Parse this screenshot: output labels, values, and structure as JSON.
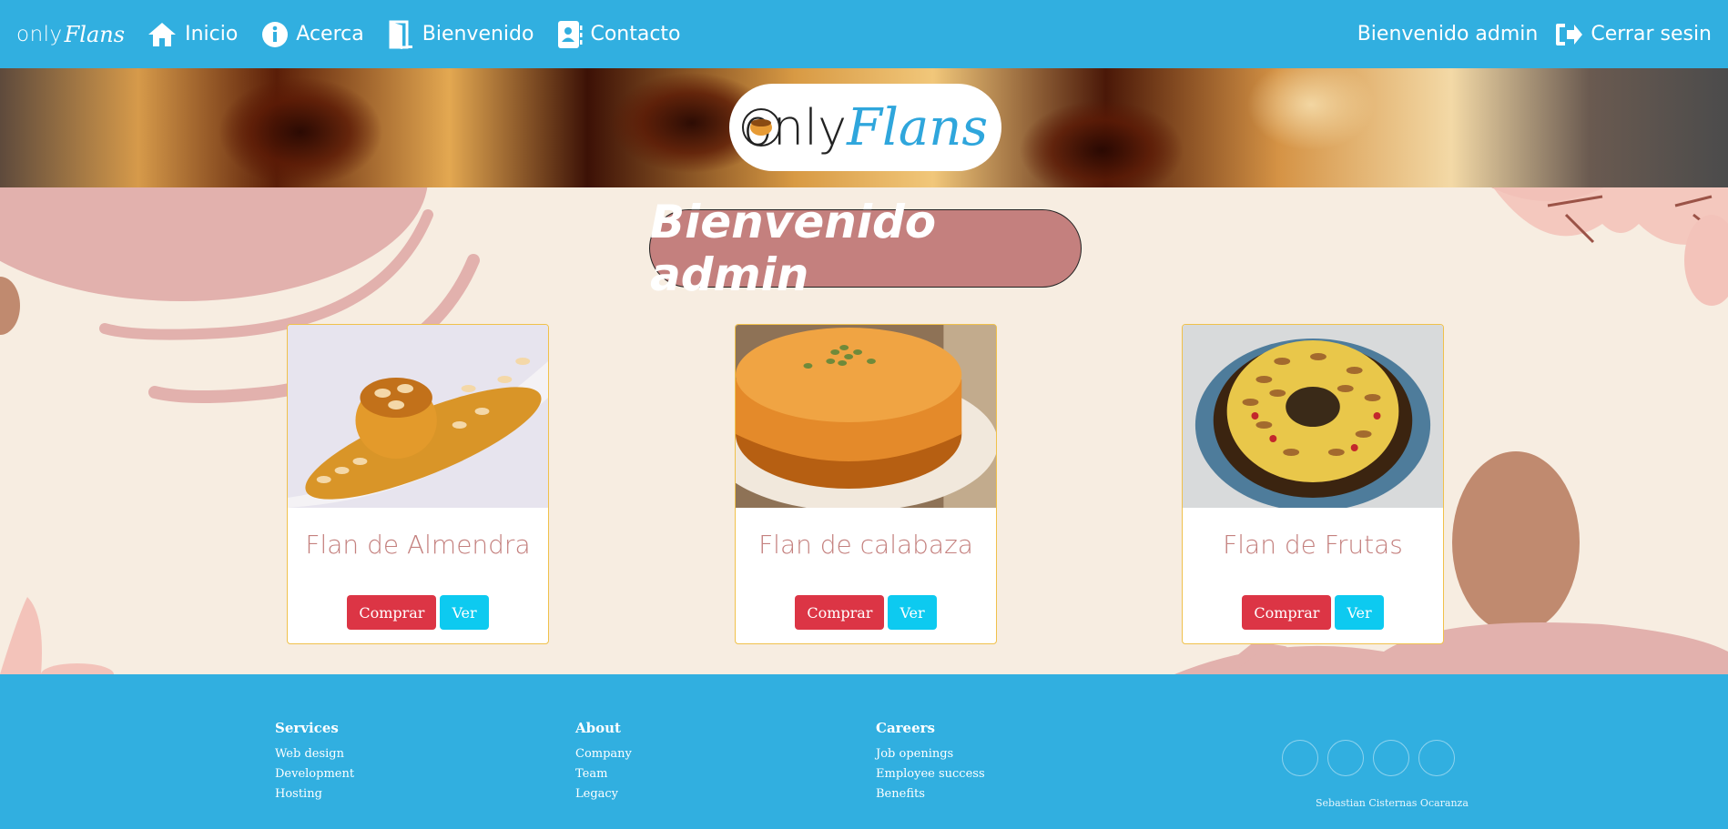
{
  "navbar": {
    "brand_only": "only",
    "brand_flans": "Flans",
    "links": [
      {
        "label": "Inicio",
        "icon": "home-icon"
      },
      {
        "label": "Acerca",
        "icon": "info-icon"
      },
      {
        "label": "Bienvenido",
        "icon": "door-icon"
      },
      {
        "label": "Contacto",
        "icon": "contact-icon"
      }
    ],
    "welcome": "Bienvenido admin",
    "logout": "Cerrar sesin"
  },
  "hero": {
    "logo_only": "only",
    "logo_flans": "Flans"
  },
  "main": {
    "welcome_title": "Bienvenido admin"
  },
  "products": [
    {
      "name": "Flan de Almendra",
      "buy_label": "Comprar",
      "view_label": "Ver"
    },
    {
      "name": "Flan de calabaza",
      "buy_label": "Comprar",
      "view_label": "Ver"
    },
    {
      "name": "Flan de Frutas",
      "buy_label": "Comprar",
      "view_label": "Ver"
    }
  ],
  "footer": {
    "columns": [
      {
        "heading": "Services",
        "links": [
          "Web design",
          "Development",
          "Hosting"
        ]
      },
      {
        "heading": "About",
        "links": [
          "Company",
          "Team",
          "Legacy"
        ]
      },
      {
        "heading": "Careers",
        "links": [
          "Job openings",
          "Employee success",
          "Benefits"
        ]
      }
    ],
    "copyright": "Sebastian Cisternas Ocaranza"
  },
  "colors": {
    "primary": "#31afe0",
    "accent_rose": "#c4807e",
    "background": "#f7ede1",
    "buy": "#dc3545",
    "view": "#0dcaf0"
  }
}
